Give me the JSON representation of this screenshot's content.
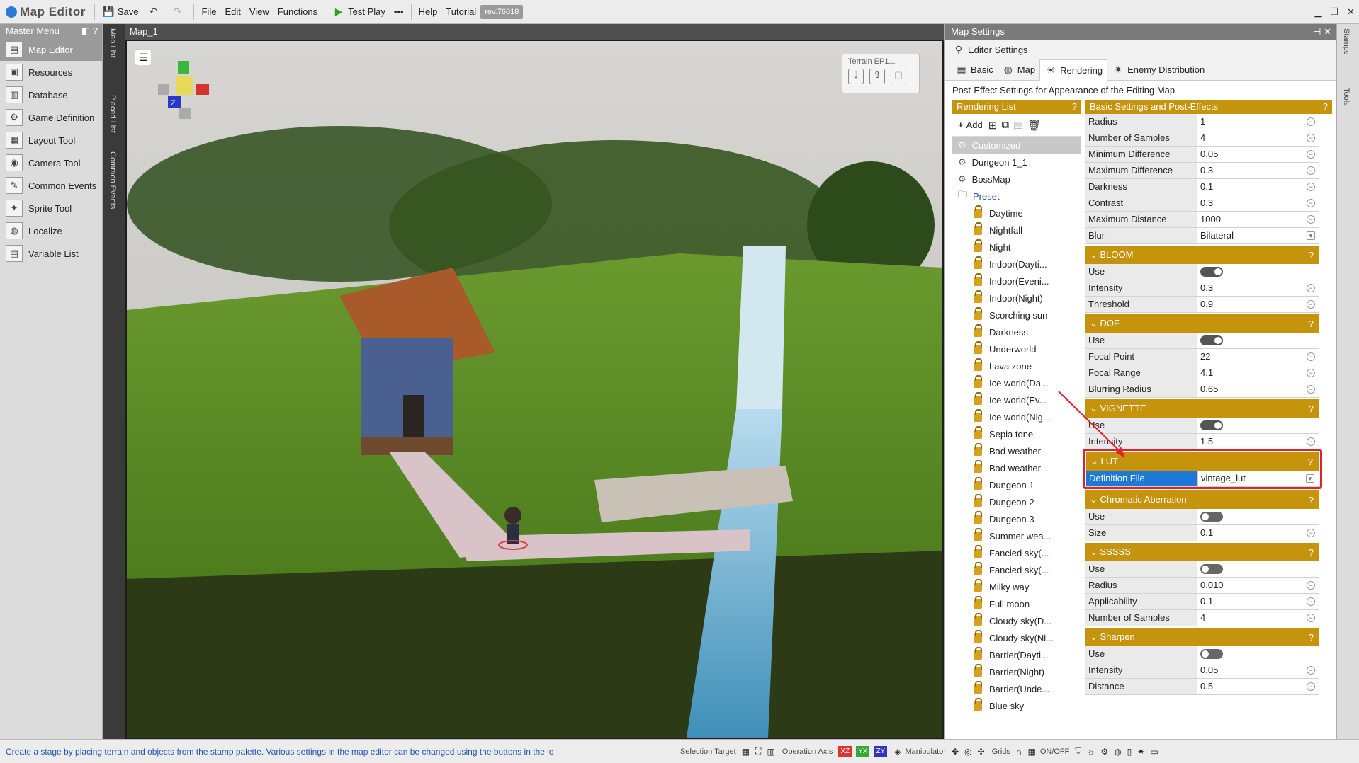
{
  "toolbar": {
    "app_title": "Map Editor",
    "save": "Save",
    "file": "File",
    "edit": "Edit",
    "view": "View",
    "functions": "Functions",
    "test_play": "Test Play",
    "help": "Help",
    "tutorial": "Tutorial",
    "rev": "rev.76018"
  },
  "master_menu": {
    "title": "Master Menu",
    "items": [
      "Map Editor",
      "Resources",
      "Database",
      "Game Definition",
      "Layout Tool",
      "Camera Tool",
      "Common Events",
      "Sprite Tool",
      "Localize",
      "Variable List"
    ]
  },
  "side_tabs": [
    "Map List",
    "Placed List",
    "Common Events"
  ],
  "map": {
    "tab": "Map_1",
    "terrain_palette": "Terrain EP1...",
    "gizmo_label": "Z"
  },
  "settings": {
    "panel_title": "Map Settings",
    "editor_settings": "Editor Settings",
    "tabs": [
      "Basic",
      "Map",
      "Rendering",
      "Enemy Distribution"
    ],
    "description": "Post-Effect Settings for Appearance of the Editing Map",
    "rendering_list_title": "Rendering List",
    "basic_title": "Basic Settings and Post-Effects",
    "add": "Add",
    "rendering_list": [
      "Customized",
      "Dungeon 1_1",
      "BossMap"
    ],
    "preset_label": "Preset",
    "presets": [
      "Daytime",
      "Nightfall",
      "Night",
      "Indoor(Dayti...",
      "Indoor(Eveni...",
      "Indoor(Night)",
      "Scorching sun",
      "Darkness",
      "Underworld",
      "Lava zone",
      "Ice world(Da...",
      "Ice world(Ev...",
      "Ice world(Nig...",
      "Sepia tone",
      "Bad weather",
      "Bad weather...",
      "Dungeon 1",
      "Dungeon 2",
      "Dungeon 3",
      "Summer wea...",
      "Fancied sky(...",
      "Fancied sky(...",
      "Milky way",
      "Full moon",
      "Cloudy sky(D...",
      "Cloudy sky(Ni...",
      "Barrier(Dayti...",
      "Barrier(Night)",
      "Barrier(Unde...",
      "Blue sky"
    ],
    "basic_props": [
      [
        "Radius",
        "1"
      ],
      [
        "Number of Samples",
        "4"
      ],
      [
        "Minimum Difference",
        "0.05"
      ],
      [
        "Maximum Difference",
        "0.3"
      ],
      [
        "Darkness",
        "0.1"
      ],
      [
        "Contrast",
        "0.3"
      ],
      [
        "Maximum Distance",
        "1000"
      ],
      [
        "Blur",
        "Bilateral"
      ]
    ],
    "bloom": {
      "title": "BLOOM",
      "use": "Use",
      "props": [
        [
          "Intensity",
          "0.3"
        ],
        [
          "Threshold",
          "0.9"
        ]
      ]
    },
    "dof": {
      "title": "DOF",
      "use": "Use",
      "props": [
        [
          "Focal Point",
          "22"
        ],
        [
          "Focal Range",
          "4.1"
        ],
        [
          "Blurring Radius",
          "0.65"
        ]
      ]
    },
    "vignette": {
      "title": "VIGNETTE",
      "use": "Use",
      "props": [
        [
          "Intensity",
          "1.5"
        ]
      ]
    },
    "lut": {
      "title": "LUT",
      "key": "Definition File",
      "value": "vintage_lut"
    },
    "chromatic": {
      "title": "Chromatic Aberration",
      "use": "Use",
      "props": [
        [
          "Size",
          "0.1"
        ]
      ]
    },
    "sssss": {
      "title": "SSSSS",
      "use": "Use",
      "props": [
        [
          "Radius",
          "0.010"
        ],
        [
          "Applicability",
          "0.1"
        ],
        [
          "Number of Samples",
          "4"
        ]
      ]
    },
    "sharpen": {
      "title": "Sharpen",
      "use": "Use",
      "props": [
        [
          "Intensity",
          "0.05"
        ],
        [
          "Distance",
          "0.5"
        ]
      ]
    }
  },
  "right_tabs": [
    "Stamps",
    "Tools"
  ],
  "status": {
    "message": "Create a stage by placing terrain and objects from the stamp palette.  Various settings in the map editor can be changed using the buttons in the lo",
    "selection_target": "Selection Target",
    "operation_axis": "Operation Axis",
    "manipulator": "Manipulator",
    "grids": "Grids",
    "onoff": "ON/OFF"
  }
}
